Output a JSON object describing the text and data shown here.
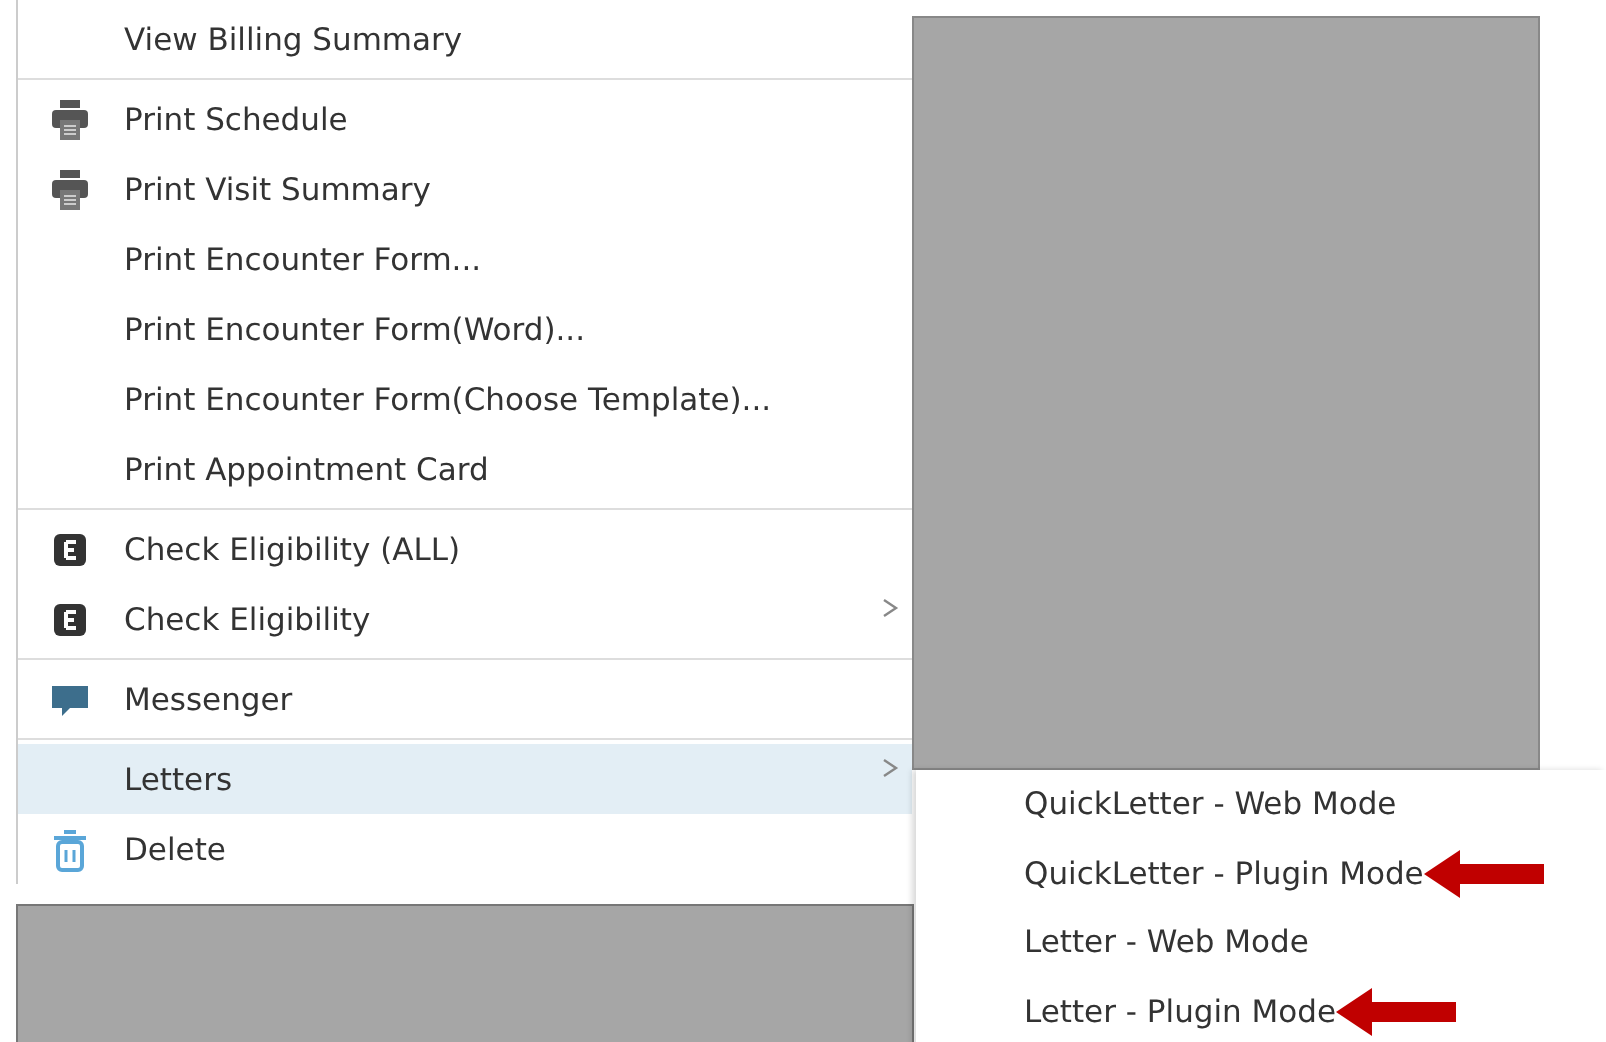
{
  "menu": {
    "sections": [
      {
        "items": [
          {
            "label": "View Billing Summary",
            "kind": "plain",
            "submenu": false,
            "selected": false
          }
        ]
      },
      {
        "items": [
          {
            "label": "Print Schedule",
            "kind": "print",
            "submenu": false,
            "selected": false
          },
          {
            "label": "Print Visit Summary",
            "kind": "print",
            "submenu": false,
            "selected": false
          },
          {
            "label": "Print Encounter Form...",
            "kind": "plain",
            "submenu": false,
            "selected": false
          },
          {
            "label": "Print Encounter Form(Word)...",
            "kind": "plain",
            "submenu": false,
            "selected": false
          },
          {
            "label": "Print Encounter Form(Choose Template)...",
            "kind": "plain",
            "submenu": false,
            "selected": false
          },
          {
            "label": "Print Appointment Card",
            "kind": "plain",
            "submenu": false,
            "selected": false
          }
        ]
      },
      {
        "items": [
          {
            "label": "Check Eligibility (ALL)",
            "kind": "eligibility",
            "submenu": false,
            "selected": false
          },
          {
            "label": "Check Eligibility",
            "kind": "eligibility",
            "submenu": true,
            "selected": false
          }
        ]
      },
      {
        "items": [
          {
            "label": "Messenger",
            "kind": "messenger",
            "submenu": false,
            "selected": false
          }
        ]
      },
      {
        "items": [
          {
            "label": "Letters",
            "kind": "plain",
            "submenu": true,
            "selected": true
          },
          {
            "label": "Delete",
            "kind": "delete",
            "submenu": false,
            "selected": false
          }
        ]
      }
    ]
  },
  "submenu": {
    "items": [
      {
        "label": "QuickLetter - Web Mode",
        "pointed_at": false
      },
      {
        "label": "QuickLetter - Plugin Mode",
        "pointed_at": true
      },
      {
        "label": "Letter - Web Mode",
        "pointed_at": false
      },
      {
        "label": "Letter - Plugin Mode",
        "pointed_at": true
      }
    ]
  }
}
